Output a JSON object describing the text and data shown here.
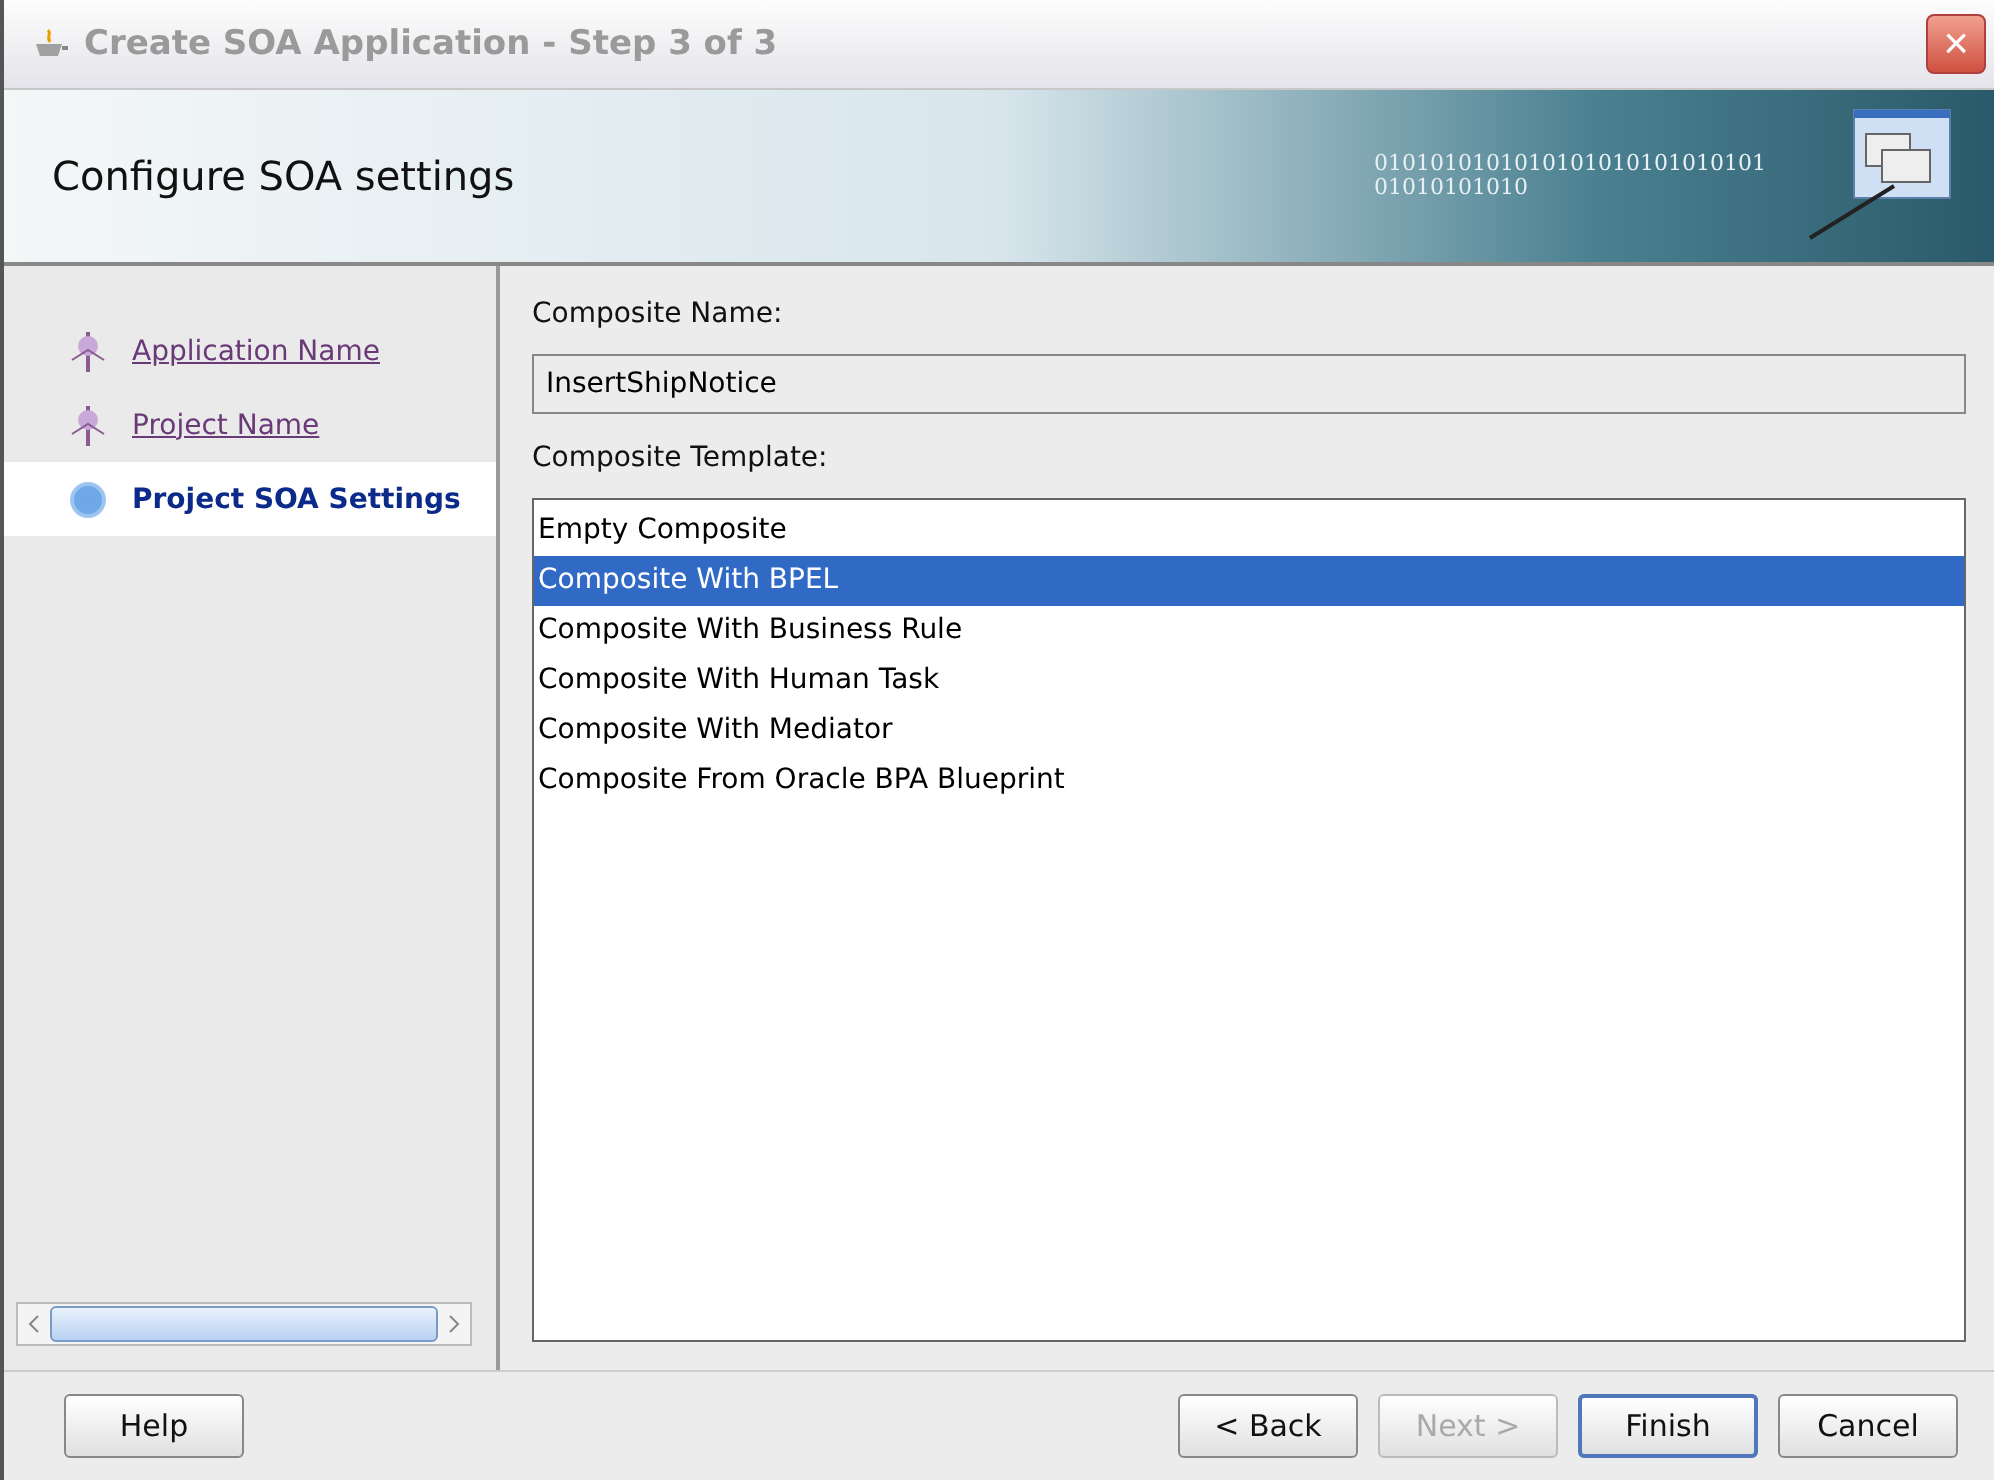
{
  "window": {
    "title": "Create SOA Application - Step 3 of 3",
    "close": "×"
  },
  "header": {
    "title": "Configure SOA settings",
    "binary": "0101010101010101010101010101",
    "binary2": "01010101010"
  },
  "train": [
    {
      "label": "Application Name",
      "selected": false
    },
    {
      "label": "Project Name",
      "selected": false
    },
    {
      "label": "Project SOA Settings",
      "selected": true
    }
  ],
  "form": {
    "name_label": "Composite Name:",
    "name_value": "InsertShipNotice",
    "template_label": "Composite Template:",
    "templates": [
      {
        "label": "Empty Composite",
        "selected": false
      },
      {
        "label": "Composite With BPEL",
        "selected": true
      },
      {
        "label": "Composite With Business Rule",
        "selected": false
      },
      {
        "label": "Composite With Human Task",
        "selected": false
      },
      {
        "label": "Composite With Mediator",
        "selected": false
      },
      {
        "label": "Composite From Oracle BPA Blueprint",
        "selected": false
      }
    ]
  },
  "buttons": [
    {
      "label": "Help",
      "kind": "left",
      "disabled": false,
      "default": false
    },
    {
      "label": "< Back",
      "kind": "right",
      "disabled": false,
      "default": false
    },
    {
      "label": "Next >",
      "kind": "right",
      "disabled": true,
      "default": false
    },
    {
      "label": "Finish",
      "kind": "right",
      "disabled": false,
      "default": true
    },
    {
      "label": "Cancel",
      "kind": "right",
      "disabled": false,
      "default": false
    }
  ]
}
